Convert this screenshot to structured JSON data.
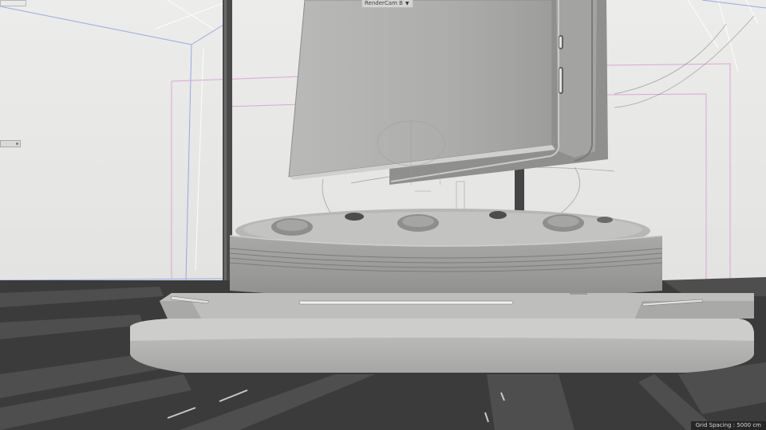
{
  "viewport": {
    "camera_name": "RenderCam B",
    "camera_menu_icon": "triangle-down-icon",
    "grid_spacing": "Grid Spacing : 5000 cm"
  },
  "colors": {
    "background": "#e6e6e4",
    "floor": "#3d3d3d",
    "model_base": "#bdbdbb",
    "selection_pink": "#d99ad9",
    "guide_blue": "#7f8fe6",
    "hud_dark": "#262626"
  }
}
